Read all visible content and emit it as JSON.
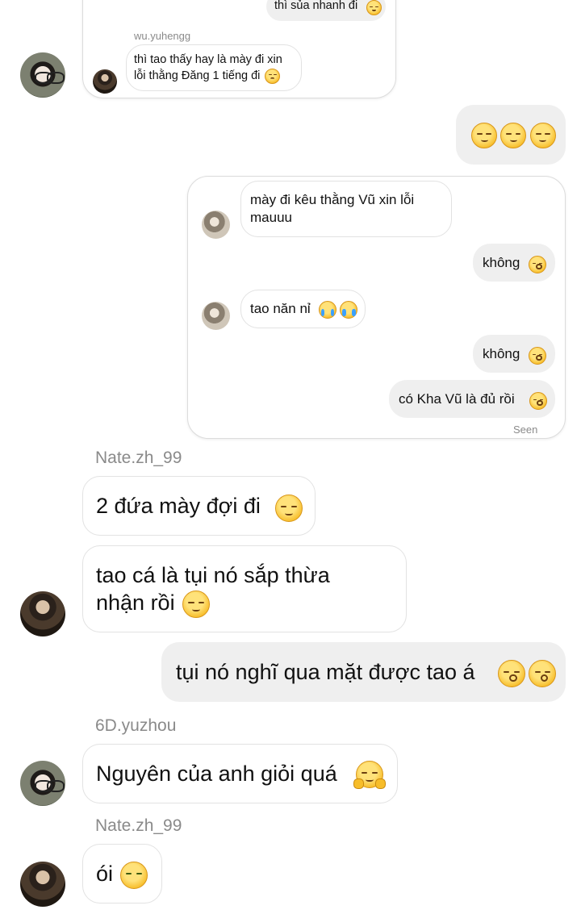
{
  "top_card": {
    "partial_message": "thì sủa nhanh đi",
    "sender": "wu.yuhengg",
    "message": "thì tao thấy hay là mày đi xin lỗi thằng Đăng 1 tiếng đi",
    "message_line1": "thì tao thấy hay là mày đi xin",
    "message_line2": "lỗi thằng Đăng 1 tiếng đi"
  },
  "sent_emoji_only": "☺☺☺",
  "shared_card": {
    "msg1_line1": "mày đi kêu thằng Vũ xin lỗi",
    "msg1_line2": "mauuu",
    "msg2": "không",
    "msg3": "tao năn nỉ",
    "msg4": "không",
    "msg5": "có Kha Vũ là đủ rồi",
    "status": "Seen"
  },
  "messages": [
    {
      "sender": "Nate.zh_99",
      "text": "2 đứa mày đợi đi"
    },
    {
      "sender": "",
      "line1": "tao cá là tụi nó sắp thừa",
      "line2": "nhận rồi"
    },
    {
      "sender": "",
      "text": "tụi nó nghĩ qua mặt được tao á"
    },
    {
      "sender": "6D.yuzhou",
      "text": "Nguyên của anh giỏi quá"
    },
    {
      "sender": "Nate.zh_99",
      "text": "ói"
    }
  ],
  "icons": {
    "relieved": "relieved-face-icon",
    "kissing": "kissing-face-icon",
    "crying": "loudly-crying-face-icon",
    "disappointed": "disappointed-face-icon",
    "hugging": "hugging-face-icon",
    "vomiting": "vomiting-face-icon"
  }
}
